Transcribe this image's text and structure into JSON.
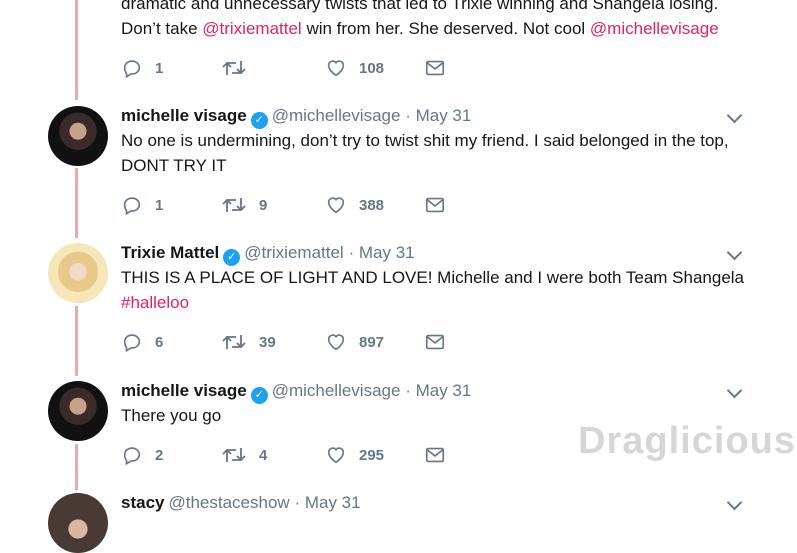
{
  "tweet0": {
    "text_start": "dramatic and unnecessary twists that led to Trixie winning and Shangela losing.",
    "text_a": "Don’t take ",
    "mention_a": "@trixiemattel",
    "text_b": " win from her. She deserved. Not cool ",
    "mention_b": "@michellevisage",
    "replies": "1",
    "retweets": "",
    "likes": "108"
  },
  "tweet1": {
    "name": "michelle visage",
    "handle": "@michellevisage",
    "date": "May 31",
    "text": "No one is undermining, don’t try to twist shit my friend. I said belonged in the top, DONT TRY IT",
    "replies": "1",
    "retweets": "9",
    "likes": "388"
  },
  "tweet2": {
    "name": "Trixie Mattel",
    "handle": "@trixiemattel",
    "date": "May 31",
    "text": "THIS IS A PLACE OF LIGHT AND LOVE! Michelle and I were both Team Shangela ",
    "hashtag": "#halleloo",
    "replies": "6",
    "retweets": "39",
    "likes": "897"
  },
  "tweet3": {
    "name": "michelle visage",
    "handle": "@michellevisage",
    "date": "May 31",
    "text": "There you go",
    "replies": "2",
    "retweets": "4",
    "likes": "295"
  },
  "tweet4": {
    "name": "stacy",
    "handle": "@thestaceshow",
    "date": "May 31"
  },
  "separator": "·",
  "verified_glyph": "✓",
  "watermark": "Draglicious",
  "colors": {
    "link": "#e0245e",
    "verified": "#1da1f2",
    "muted": "#657786",
    "thread_line": "#e8a8ad"
  },
  "icons": [
    "reply-icon",
    "retweet-icon",
    "like-icon",
    "message-icon",
    "verified-icon",
    "chevron-down-icon"
  ]
}
